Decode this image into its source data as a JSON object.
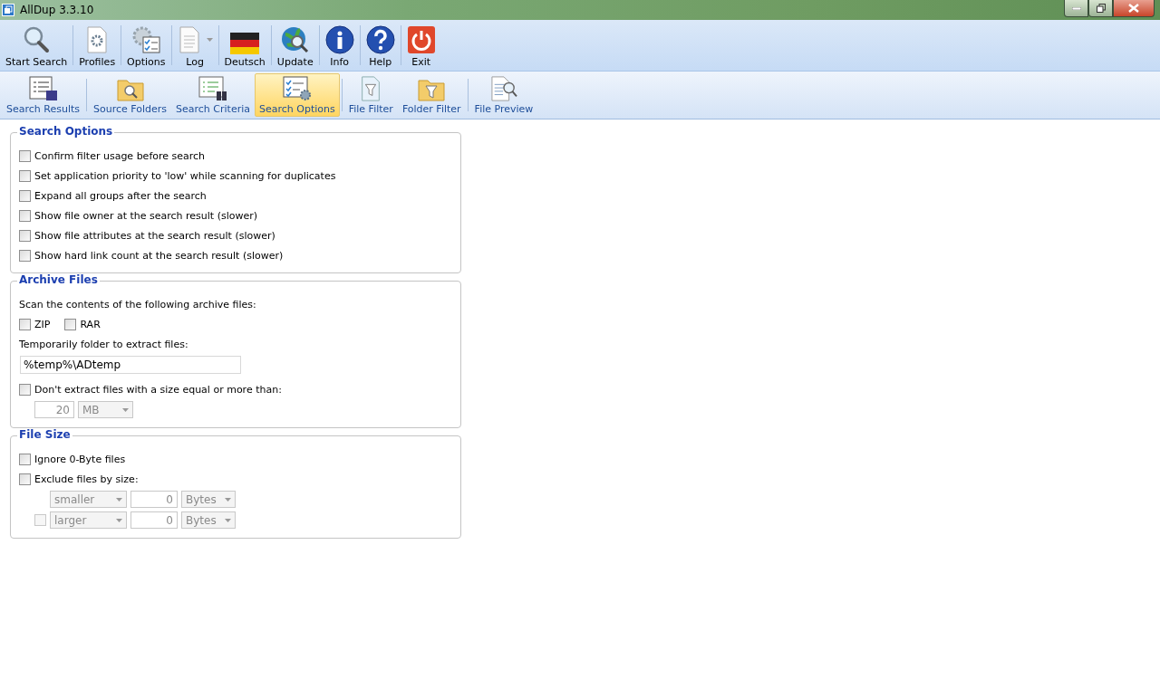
{
  "window": {
    "title": "AllDup 3.3.10"
  },
  "toolbar": [
    {
      "label": "Start Search",
      "dropdown": false
    },
    {
      "label": "Profiles",
      "dropdown": false
    },
    {
      "label": "Options",
      "dropdown": false
    },
    {
      "label": "Log",
      "dropdown": true
    },
    {
      "label": "Deutsch",
      "dropdown": false
    },
    {
      "label": "Update",
      "dropdown": false
    },
    {
      "label": "Info",
      "dropdown": false
    },
    {
      "label": "Help",
      "dropdown": false
    },
    {
      "label": "Exit",
      "dropdown": false
    }
  ],
  "tabs": [
    {
      "label": "Search Results",
      "selected": false
    },
    {
      "label": "Source Folders",
      "selected": false
    },
    {
      "label": "Search Criteria",
      "selected": false
    },
    {
      "label": "Search Options",
      "selected": true
    },
    {
      "label": "File Filter",
      "selected": false
    },
    {
      "label": "Folder Filter",
      "selected": false
    },
    {
      "label": "File Preview",
      "selected": false
    }
  ],
  "search_options": {
    "title": "Search Options",
    "options": [
      {
        "label": "Confirm filter usage before search",
        "checked": false
      },
      {
        "label": "Set application priority to 'low' while scanning for duplicates",
        "checked": false
      },
      {
        "label": "Expand all groups after the search",
        "checked": false
      },
      {
        "label": "Show file owner at the search result (slower)",
        "checked": false
      },
      {
        "label": "Show file attributes at the search result (slower)",
        "checked": false
      },
      {
        "label": "Show hard link count at the search result (slower)",
        "checked": false
      }
    ]
  },
  "archive_files": {
    "title": "Archive Files",
    "prompt": "Scan the contents of the following archive files:",
    "formats": [
      {
        "label": "ZIP",
        "checked": false
      },
      {
        "label": "RAR",
        "checked": false
      }
    ],
    "folder_label": "Temporarily folder to extract files:",
    "folder_value": "%temp%\\ADtemp",
    "size_limit": {
      "label": "Don't extract files with a size equal or more than:",
      "checked": false,
      "value": "20",
      "unit": "MB",
      "disabled": true
    }
  },
  "file_size": {
    "title": "File Size",
    "ignore_zero": {
      "label": "Ignore 0-Byte files",
      "checked": false
    },
    "exclude": {
      "label": "Exclude files by size:",
      "checked": false
    },
    "rows": [
      {
        "kind": "plain",
        "comparison": "smaller",
        "value": "0",
        "unit": "Bytes",
        "disabled": true
      },
      {
        "kind": "toggle",
        "checked": false,
        "comparison": "larger",
        "value": "0",
        "unit": "Bytes",
        "disabled": true
      }
    ]
  }
}
